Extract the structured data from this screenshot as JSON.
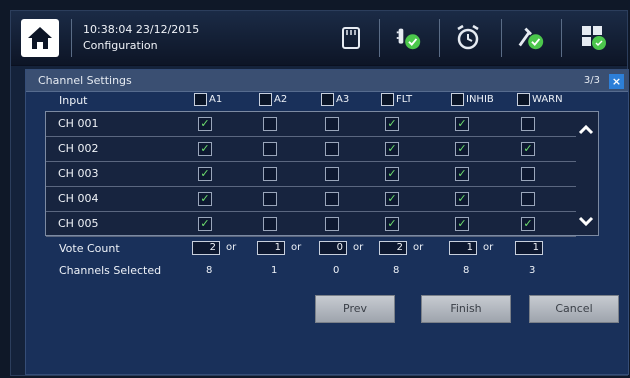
{
  "header": {
    "time": "10:38:04 23/12/2015",
    "subtitle": "Configuration",
    "icons": [
      "home-icon",
      "storage-card-icon",
      "power-plug-ok-icon",
      "alarm-clock-icon",
      "tools-ok-icon",
      "layout-grid-icon"
    ]
  },
  "dialog": {
    "title": "Channel Settings",
    "page": "3/3",
    "close_label": "×",
    "input_label": "Input",
    "vote_label": "Vote Count",
    "selected_label": "Channels Selected",
    "or_label": "or",
    "columns": [
      "A1",
      "A2",
      "A3",
      "FLT",
      "INHIB",
      "WARN"
    ],
    "rows": [
      {
        "label": "CH 001",
        "checks": [
          true,
          false,
          false,
          true,
          true,
          false
        ]
      },
      {
        "label": "CH 002",
        "checks": [
          true,
          false,
          false,
          true,
          true,
          true
        ]
      },
      {
        "label": "CH 003",
        "checks": [
          true,
          false,
          false,
          true,
          true,
          false
        ]
      },
      {
        "label": "CH 004",
        "checks": [
          true,
          false,
          false,
          true,
          true,
          false
        ]
      },
      {
        "label": "CH 005",
        "checks": [
          true,
          false,
          false,
          true,
          true,
          true
        ]
      }
    ],
    "vote_counts": [
      "2",
      "1",
      "0",
      "2",
      "1",
      "1"
    ],
    "channels_selected": [
      "8",
      "1",
      "0",
      "8",
      "8",
      "3"
    ],
    "buttons": {
      "prev": "Prev",
      "finish": "Finish",
      "cancel": "Cancel"
    }
  },
  "colors": {
    "accent": "#2d7fd8",
    "check": "#6fe06f",
    "dialog_bg": "#19305a"
  }
}
